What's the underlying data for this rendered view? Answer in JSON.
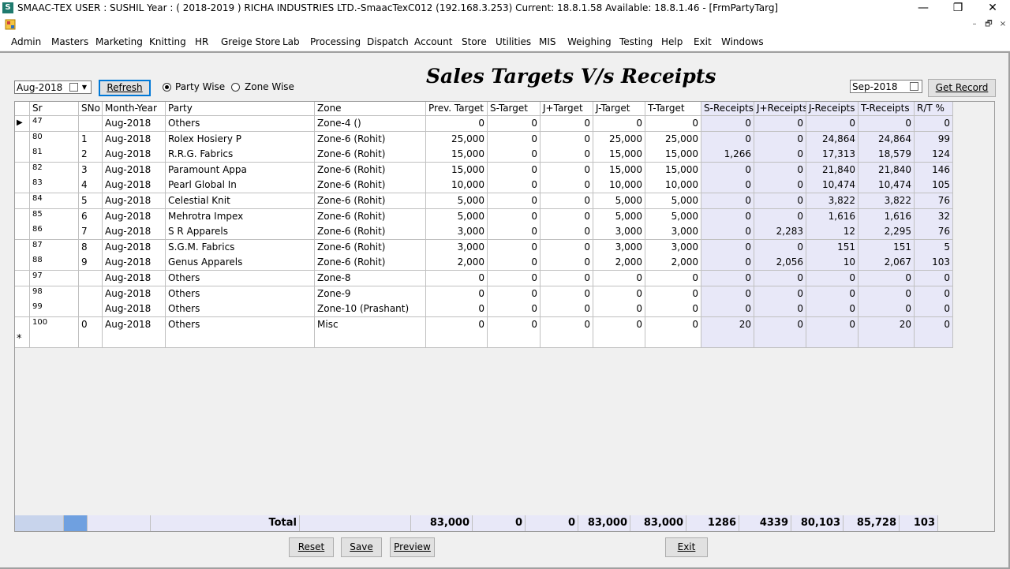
{
  "window": {
    "title": "SMAAC-TEX  USER : SUSHIL  Year : ( 2018-2019 )   RICHA INDUSTRIES LTD.-SmaacTexC012 (192.168.3.253)  Current: 18.8.1.58  Available: 18.8.1.46  - [FrmPartyTarg]",
    "app_icon": "S",
    "min": "—",
    "restore": "❐",
    "close": "✕"
  },
  "mdi": {
    "min": "–",
    "restore": "🗗",
    "close": "×"
  },
  "menu": [
    "Admin",
    "Masters",
    "Marketing",
    "Knitting",
    "HR",
    "Greige Store",
    "Lab",
    "Processing",
    "Dispatch",
    "Account",
    "Store",
    "Utilities",
    "MIS",
    "Weighing",
    "Testing",
    "Help",
    "Exit",
    "Windows"
  ],
  "toolbar": {
    "month_value": "Aug-2018",
    "refresh_label": "Refresh",
    "party_wise_label": "Party Wise",
    "zone_wise_label": "Zone Wise",
    "heading": "Sales Targets V/s Receipts",
    "to_month_value": "Sep-2018",
    "get_record_label": "Get Record"
  },
  "columns": [
    "Sr",
    "SNo",
    "Month-Year",
    "Party",
    "Zone",
    "Prev. Target",
    "S-Target",
    "J+Target",
    "J-Target",
    "T-Target",
    "S-Receipts",
    "J+Receipts",
    "J-Receipts",
    "T-Receipts",
    "R/T %"
  ],
  "rows": [
    [
      "47",
      "",
      "Aug-2018",
      "Others",
      "Zone-4 ()",
      "0",
      "0",
      "0",
      "0",
      "0",
      "0",
      "0",
      "0",
      "0",
      "0"
    ],
    [
      "80",
      "1",
      "Aug-2018",
      "Rolex Hosiery P",
      "Zone-6 (Rohit)",
      "25,000",
      "0",
      "0",
      "25,000",
      "25,000",
      "0",
      "0",
      "24,864",
      "24,864",
      "99"
    ],
    [
      "81",
      "2",
      "Aug-2018",
      "R.R.G. Fabrics",
      "Zone-6 (Rohit)",
      "15,000",
      "0",
      "0",
      "15,000",
      "15,000",
      "1,266",
      "0",
      "17,313",
      "18,579",
      "124"
    ],
    [
      "82",
      "3",
      "Aug-2018",
      "Paramount Appa",
      "Zone-6 (Rohit)",
      "15,000",
      "0",
      "0",
      "15,000",
      "15,000",
      "0",
      "0",
      "21,840",
      "21,840",
      "146"
    ],
    [
      "83",
      "4",
      "Aug-2018",
      "Pearl Global In",
      "Zone-6 (Rohit)",
      "10,000",
      "0",
      "0",
      "10,000",
      "10,000",
      "0",
      "0",
      "10,474",
      "10,474",
      "105"
    ],
    [
      "84",
      "5",
      "Aug-2018",
      "Celestial Knit",
      "Zone-6 (Rohit)",
      "5,000",
      "0",
      "0",
      "5,000",
      "5,000",
      "0",
      "0",
      "3,822",
      "3,822",
      "76"
    ],
    [
      "85",
      "6",
      "Aug-2018",
      "Mehrotra Impex",
      "Zone-6 (Rohit)",
      "5,000",
      "0",
      "0",
      "5,000",
      "5,000",
      "0",
      "0",
      "1,616",
      "1,616",
      "32"
    ],
    [
      "86",
      "7",
      "Aug-2018",
      "S R Apparels",
      "Zone-6 (Rohit)",
      "3,000",
      "0",
      "0",
      "3,000",
      "3,000",
      "0",
      "2,283",
      "12",
      "2,295",
      "76"
    ],
    [
      "87",
      "8",
      "Aug-2018",
      "S.G.M. Fabrics",
      "Zone-6 (Rohit)",
      "3,000",
      "0",
      "0",
      "3,000",
      "3,000",
      "0",
      "0",
      "151",
      "151",
      "5"
    ],
    [
      "88",
      "9",
      "Aug-2018",
      "Genus Apparels",
      "Zone-6 (Rohit)",
      "2,000",
      "0",
      "0",
      "2,000",
      "2,000",
      "0",
      "2,056",
      "10",
      "2,067",
      "103"
    ],
    [
      "97",
      "",
      "Aug-2018",
      "Others",
      "Zone-8",
      "0",
      "0",
      "0",
      "0",
      "0",
      "0",
      "0",
      "0",
      "0",
      "0"
    ],
    [
      "98",
      "",
      "Aug-2018",
      "Others",
      "Zone-9",
      "0",
      "0",
      "0",
      "0",
      "0",
      "0",
      "0",
      "0",
      "0",
      "0"
    ],
    [
      "99",
      "",
      "Aug-2018",
      "Others",
      "Zone-10 (Prashant)",
      "0",
      "0",
      "0",
      "0",
      "0",
      "0",
      "0",
      "0",
      "0",
      "0"
    ],
    [
      "100",
      "0",
      "Aug-2018",
      "Others",
      "Misc",
      "0",
      "0",
      "0",
      "0",
      "0",
      "20",
      "0",
      "0",
      "20",
      "0"
    ]
  ],
  "new_row_marker": "*",
  "current_row_marker": "▶",
  "totals": {
    "label": "Total",
    "prev_target": "83,000",
    "s_target": "0",
    "jplus_target": "0",
    "j_target": "83,000",
    "t_target": "83,000",
    "s_receipts": "1286",
    "jplus_receipts": "4339",
    "j_receipts": "80,103",
    "t_receipts": "85,728",
    "rt_pct": "103"
  },
  "footer": {
    "reset_label": "Reset",
    "save_label": "Save",
    "preview_label": "Preview",
    "exit_label": "Exit"
  }
}
